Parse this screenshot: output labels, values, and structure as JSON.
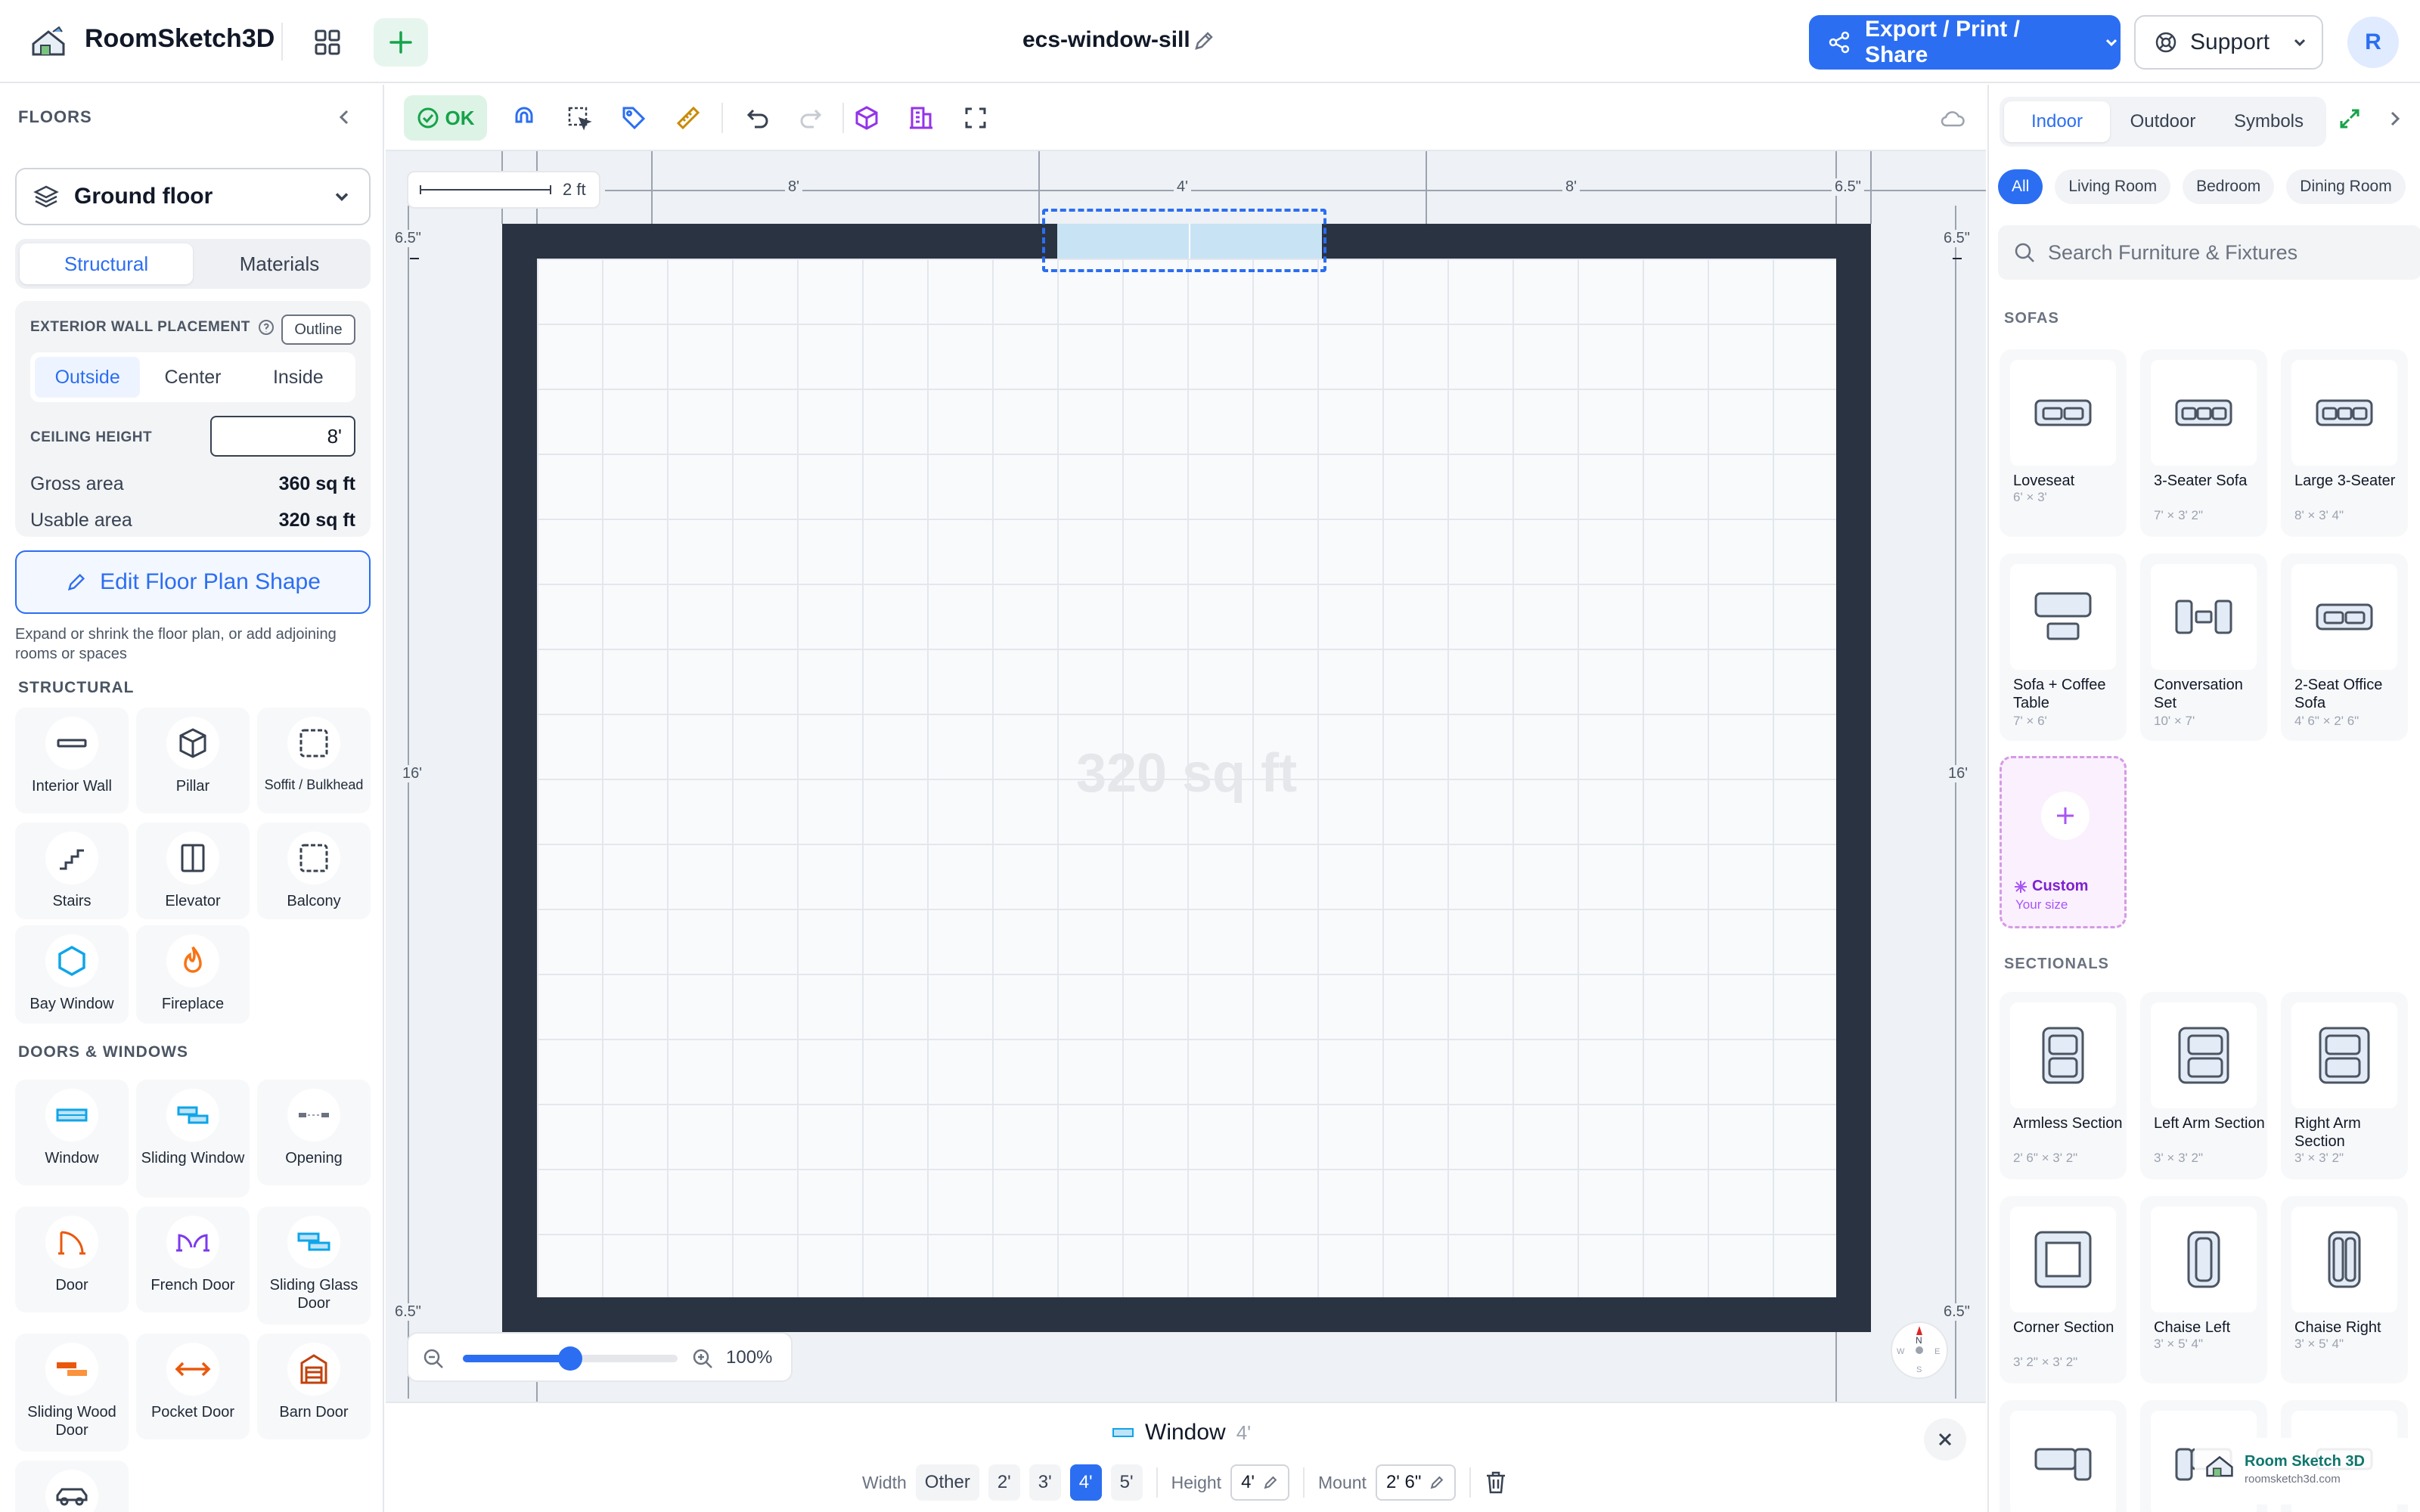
{
  "app": {
    "name": "RoomSketch3D",
    "doc_title": "ecs-window-sill"
  },
  "header": {
    "export_label": "Export / Print / Share",
    "support_label": "Support",
    "avatar_initial": "R"
  },
  "left": {
    "floors_title": "FLOORS",
    "floor_selected": "Ground floor",
    "tabs": [
      "Structural",
      "Materials"
    ],
    "ewp_label": "EXTERIOR WALL PLACEMENT",
    "outline_label": "Outline",
    "placement": [
      "Outside",
      "Center",
      "Inside"
    ],
    "ceiling_label": "CEILING HEIGHT",
    "ceiling_value": "8'",
    "gross_label": "Gross area",
    "gross_value": "360 sq ft",
    "usable_label": "Usable area",
    "usable_value": "320 sq ft",
    "edit_shape_label": "Edit Floor Plan Shape",
    "expand_note": "Expand or shrink the floor plan, or add adjoining rooms or spaces",
    "structural_title": "STRUCTURAL",
    "structural_items": [
      "Interior Wall",
      "Pillar",
      "Soffit / Bulkhead",
      "Stairs",
      "Elevator",
      "Balcony",
      "Bay Window",
      "Fireplace"
    ],
    "doors_title": "DOORS & WINDOWS",
    "door_items": [
      "Window",
      "Sliding Window",
      "Opening",
      "Door",
      "French Door",
      "Sliding Glass Door",
      "Sliding Wood Door",
      "Pocket Door",
      "Barn Door"
    ]
  },
  "toolbar": {
    "ok_label": "OK"
  },
  "canvas": {
    "scale_label": "2 ft",
    "dim_top_left": "8'",
    "dim_top_mid": "4'",
    "dim_top_right": "8'",
    "dim_top_corner": "6.5\"",
    "dim_side_tl": "6.5\"",
    "dim_side_tr": "6.5\"",
    "dim_side_bl": "6.5\"",
    "dim_side_br": "6.5\"",
    "dim_left": "16'",
    "dim_right": "16'",
    "area_label": "320 sq ft",
    "zoom_label": "100%",
    "zoom_level": 0.5,
    "compass": {
      "n": "N",
      "s": "S",
      "e": "E",
      "w": "W"
    }
  },
  "bottom": {
    "title": "Window",
    "size": "4'",
    "width_label": "Width",
    "width_options": [
      "Other",
      "2'",
      "3'",
      "4'",
      "5'"
    ],
    "width_selected": "4'",
    "height_label": "Height",
    "height_value": "4'",
    "mount_label": "Mount",
    "mount_value": "2' 6\""
  },
  "right": {
    "tabs": [
      "Indoor",
      "Outdoor",
      "Symbols"
    ],
    "categories": [
      "All",
      "Living Room",
      "Bedroom",
      "Dining Room"
    ],
    "search_placeholder": "Search Furniture & Fixtures",
    "sofas_title": "SOFAS",
    "sofas": [
      {
        "name": "Loveseat",
        "dims": "6' × 3'"
      },
      {
        "name": "3-Seater Sofa",
        "dims": "7' × 3' 2\""
      },
      {
        "name": "Large 3-Seater",
        "dims": "8' × 3' 4\""
      },
      {
        "name": "Sofa + Coffee Table",
        "dims": "7' × 6'"
      },
      {
        "name": "Conversation Set",
        "dims": "10' × 7'"
      },
      {
        "name": "2-Seat Office Sofa",
        "dims": "4' 6\" × 2' 6\""
      }
    ],
    "custom_label": "Custom",
    "custom_sub": "Your size",
    "sectionals_title": "SECTIONALS",
    "sectionals": [
      {
        "name": "Armless Section",
        "dims": "2' 6\" × 3' 2\""
      },
      {
        "name": "Left Arm Section",
        "dims": "3' × 3' 2\""
      },
      {
        "name": "Right Arm Section",
        "dims": "3' × 3' 2\""
      },
      {
        "name": "Corner Section",
        "dims": "3' 2\" × 3' 2\""
      },
      {
        "name": "Chaise Left",
        "dims": "3' × 5' 4\""
      },
      {
        "name": "Chaise Right",
        "dims": "3' × 5' 4\""
      }
    ],
    "watermark_name": "Room Sketch 3D",
    "watermark_url": "roomsketch3d.com"
  },
  "colors": {
    "accent": "#2b6ef2",
    "wall": "#2a3342",
    "window": "#c8e3f4",
    "ok_green": "#16a34a",
    "custom_purple": "#a855f7"
  }
}
